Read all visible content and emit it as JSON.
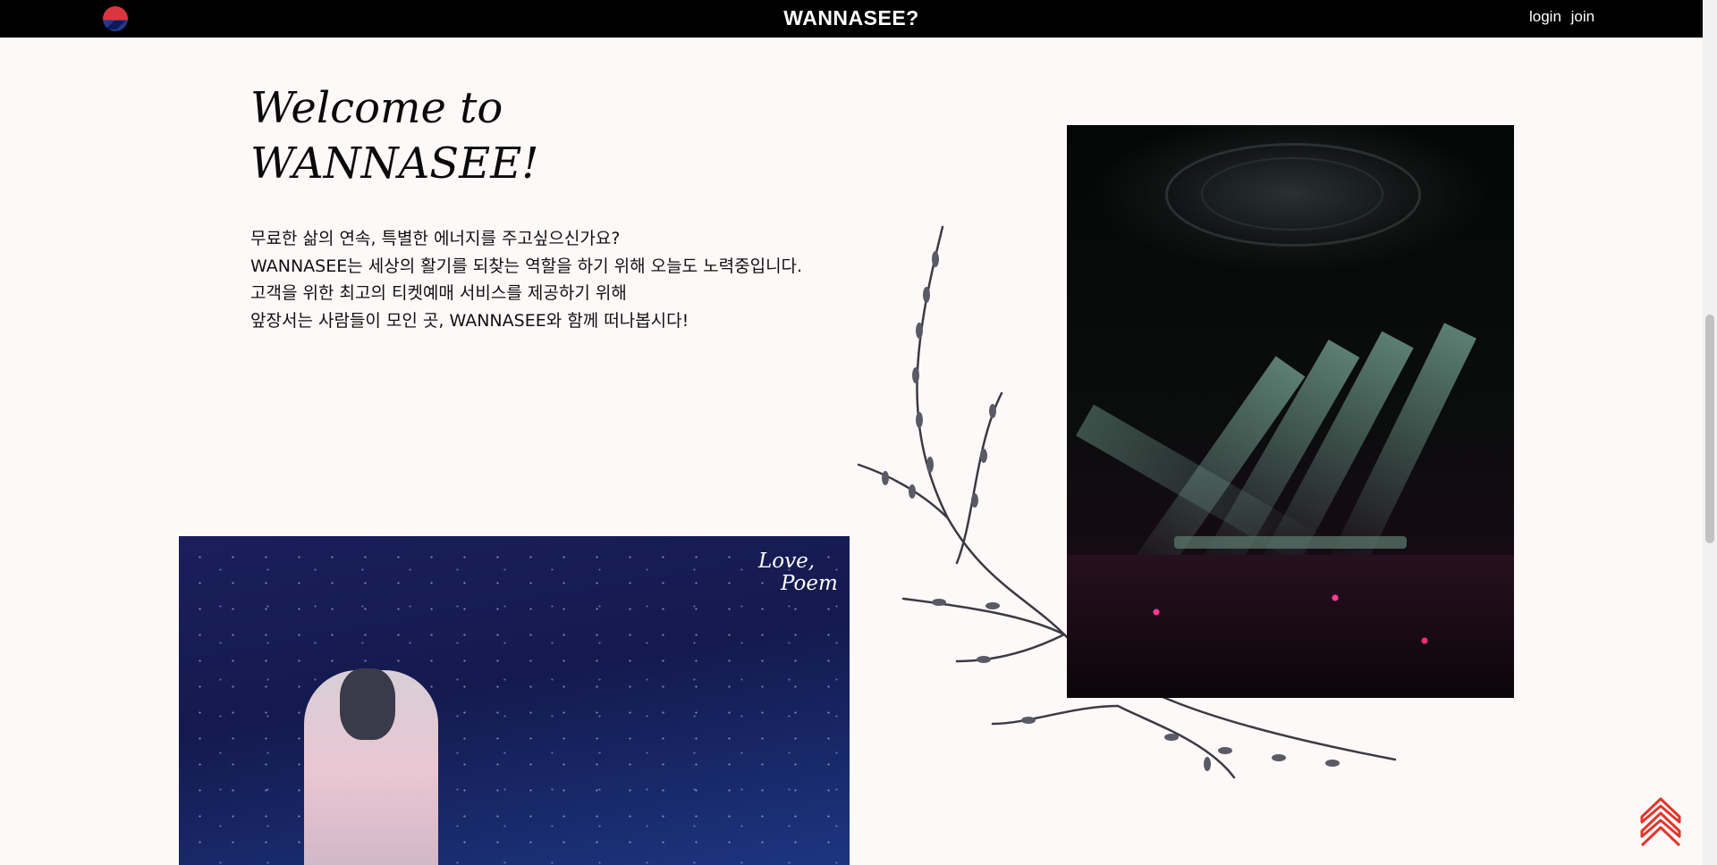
{
  "header": {
    "brand": "WANNASEE?",
    "login_label": "login",
    "join_label": "join"
  },
  "hero": {
    "title_line1": "Welcome to",
    "title_line2": "WANNASEE!",
    "paragraphs": [
      "무료한 삶의 연속, 특별한 에너지를 주고싶으신가요?",
      "WANNASEE는 세상의 활기를 되찾는 역할을 하기 위해 오늘도 노력중입니다.",
      "고객을 위한 최고의 티켓예매 서비스를 제공하기 위해",
      "앞장서는 사람들이 모인 곳, WANNASEE와 함께 떠나봅시다!"
    ]
  },
  "photos": {
    "overlay_line1": "Love,",
    "overlay_line2": "Poem"
  },
  "colors": {
    "topbar": "#000000",
    "page_background": "#fdf9f8",
    "accent": "#d9363e"
  },
  "icons": {
    "logo": "logo-icon",
    "scroll_top": "chevron-double-up-icon"
  }
}
